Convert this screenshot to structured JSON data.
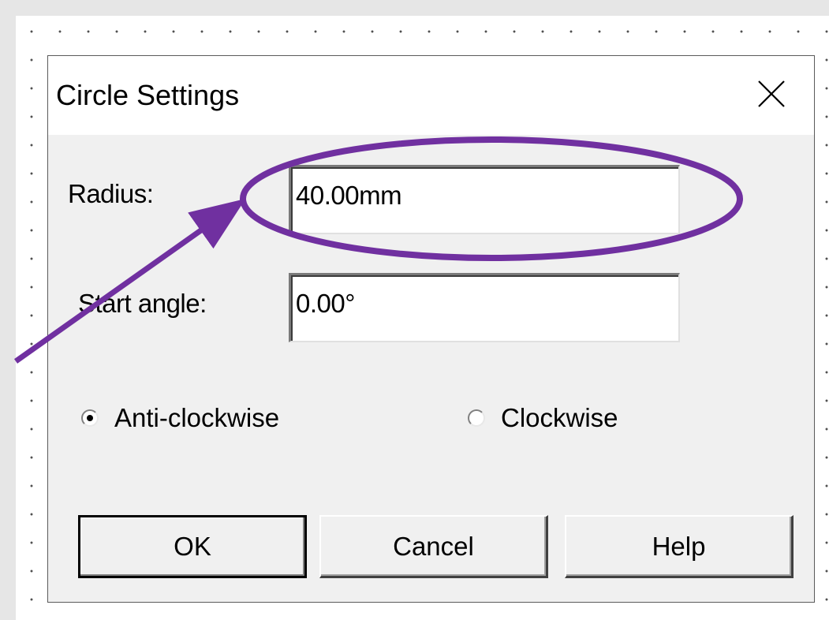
{
  "dialog": {
    "title": "Circle Settings",
    "close_icon": "close-icon"
  },
  "fields": {
    "radius": {
      "label": "Radius:",
      "value": "40.00mm"
    },
    "start_angle": {
      "label": "Start angle:",
      "value": "0.00°"
    }
  },
  "direction": {
    "options": [
      {
        "label": "Anti-clockwise",
        "checked": true
      },
      {
        "label": "Clockwise",
        "checked": false
      }
    ]
  },
  "buttons": {
    "ok": "OK",
    "cancel": "Cancel",
    "help": "Help"
  },
  "annotation": {
    "color": "#7030a0",
    "shapes": [
      "highlight-ellipse",
      "pointer-arrow"
    ]
  },
  "colors": {
    "dialog_bg": "#f0f0f0",
    "titlebar_bg": "#ffffff",
    "accent": "#7030a0"
  }
}
